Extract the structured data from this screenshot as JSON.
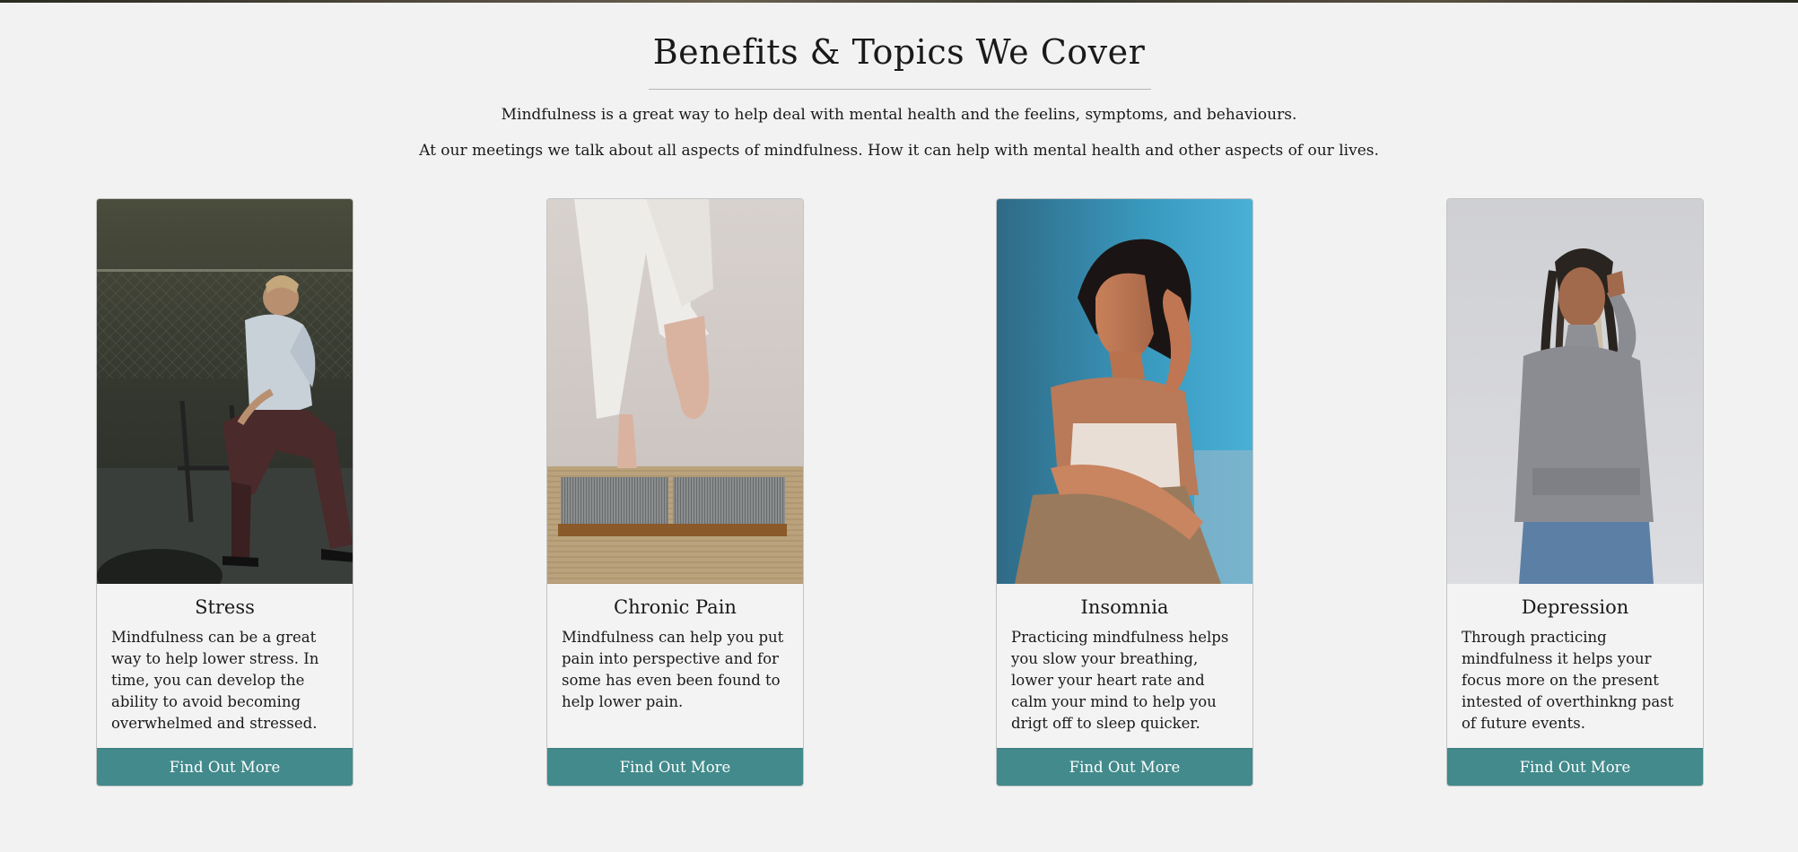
{
  "section": {
    "title": "Benefits & Topics We Cover",
    "intro": [
      "Mindfulness is a great way to help deal with mental health and the feelins, symptoms, and behaviours.",
      "At our meetings we talk about all aspects of mindfulness. How it can help with mental health and other aspects of our lives."
    ]
  },
  "cards": [
    {
      "title": "Stress",
      "text": "Mindfulness can be a great way to help lower stress. In time, you can develop the ability to avoid becoming overwhelmed and stressed.",
      "button": "Find Out More"
    },
    {
      "title": "Chronic Pain",
      "text": "Mindfulness can help you put pain into perspective and for some has even been found to help lower pain.",
      "button": "Find Out More"
    },
    {
      "title": "Insomnia",
      "text": "Practicing mindfulness helps you slow your breathing, lower your heart rate and calm your mind to help you drigt off to sleep quicker.",
      "button": "Find Out More"
    },
    {
      "title": "Depression",
      "text": "Through practicing mindfulness it helps your focus more on the present intested of overthinkng past of future events.",
      "button": "Find Out More"
    }
  ],
  "colors": {
    "page_background": "#f2f2f2",
    "button_background": "#428a8c",
    "button_text": "#ffffff"
  }
}
